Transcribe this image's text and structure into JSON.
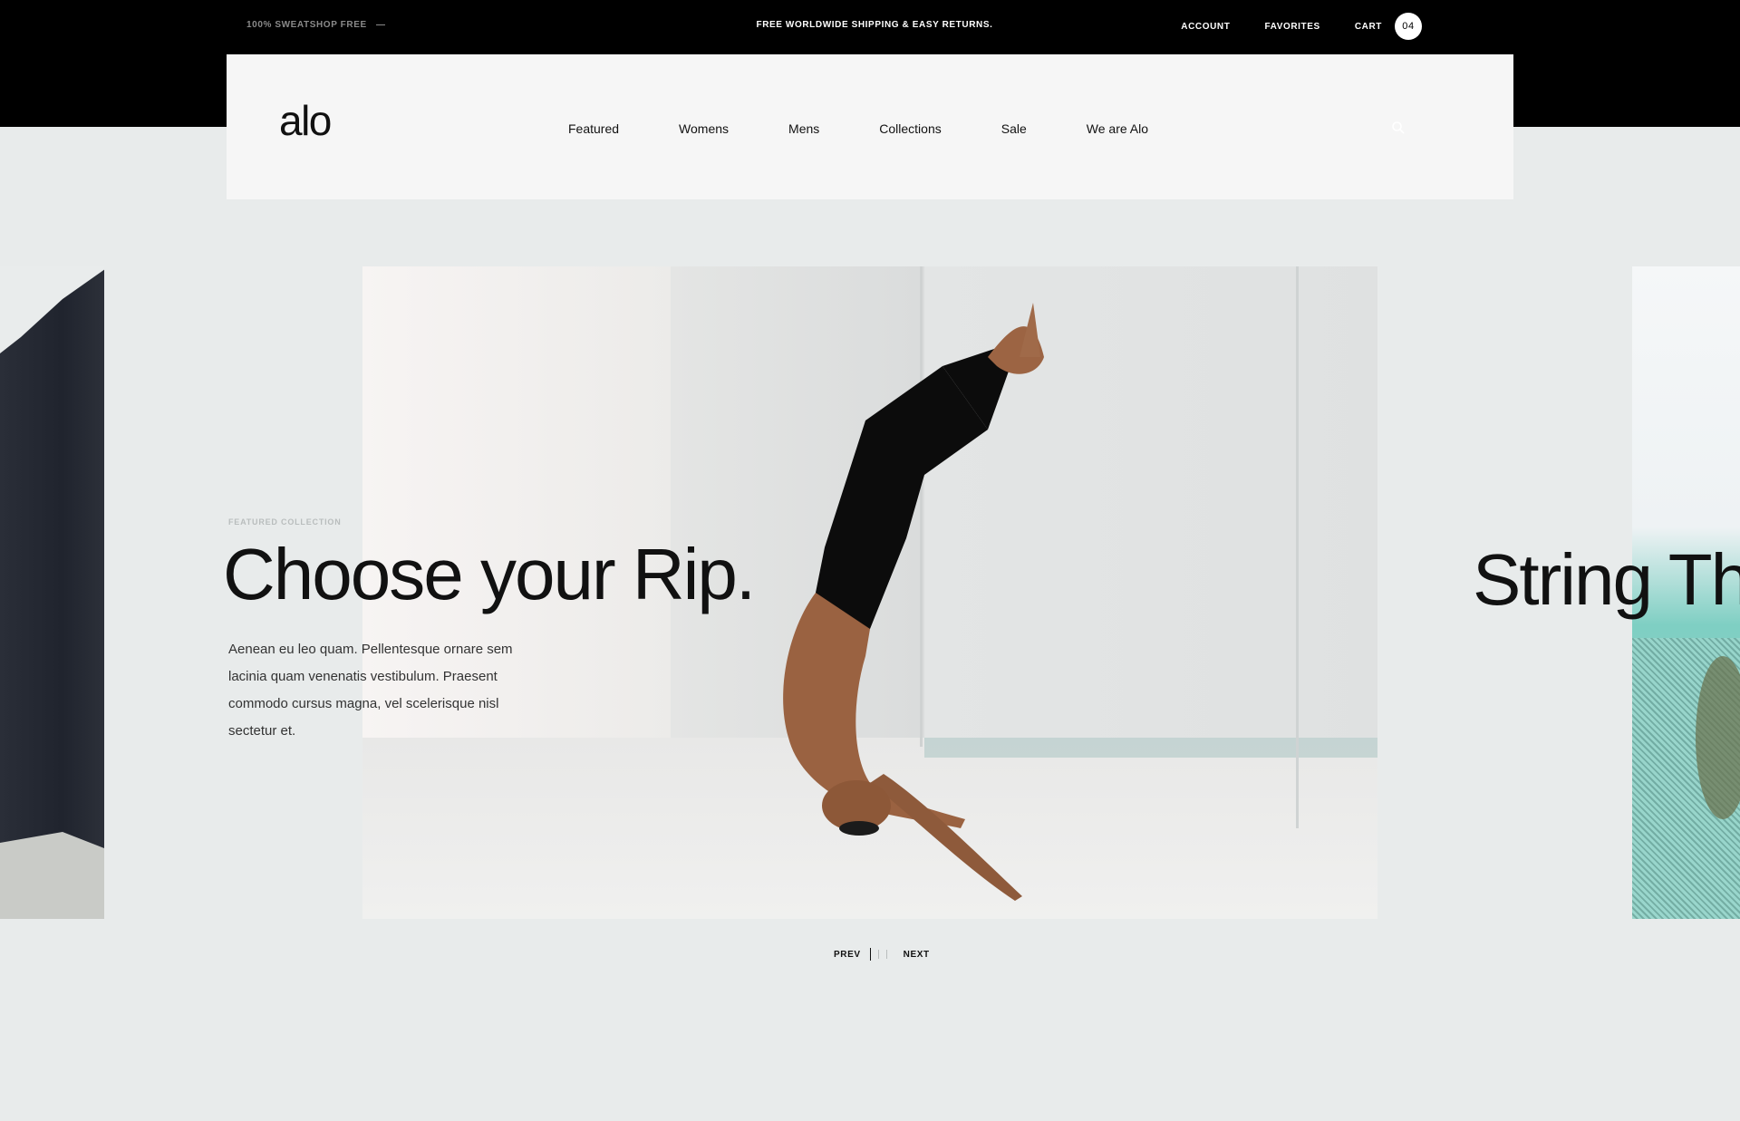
{
  "topbar": {
    "left_text": "100% SWEATSHOP FREE",
    "center_text": "FREE WORLDWIDE SHIPPING & EASY RETURNS.",
    "account": "ACCOUNT",
    "favorites": "FAVORITES",
    "cart": "CART",
    "cart_count": "04"
  },
  "header": {
    "logo": "alo",
    "nav": [
      "Featured",
      "Womens",
      "Mens",
      "Collections",
      "Sale",
      "We are Alo"
    ],
    "search_icon": "search-icon"
  },
  "hero": {
    "eyebrow": "FEATURED COLLECTION",
    "title": "Choose your Rip.",
    "description": "Aenean eu leo quam. Pellentesque ornare sem lacinia quam venenatis vestibulum. Praesent commodo cursus magna, vel scelerisque nisl sectetur et.",
    "next_title": "String Th"
  },
  "pager": {
    "prev": "PREV",
    "next": "NEXT"
  },
  "colors": {
    "background": "#e8ebeb",
    "topbar": "#000000",
    "nav_box": "#f6f6f6",
    "text": "#111111"
  }
}
